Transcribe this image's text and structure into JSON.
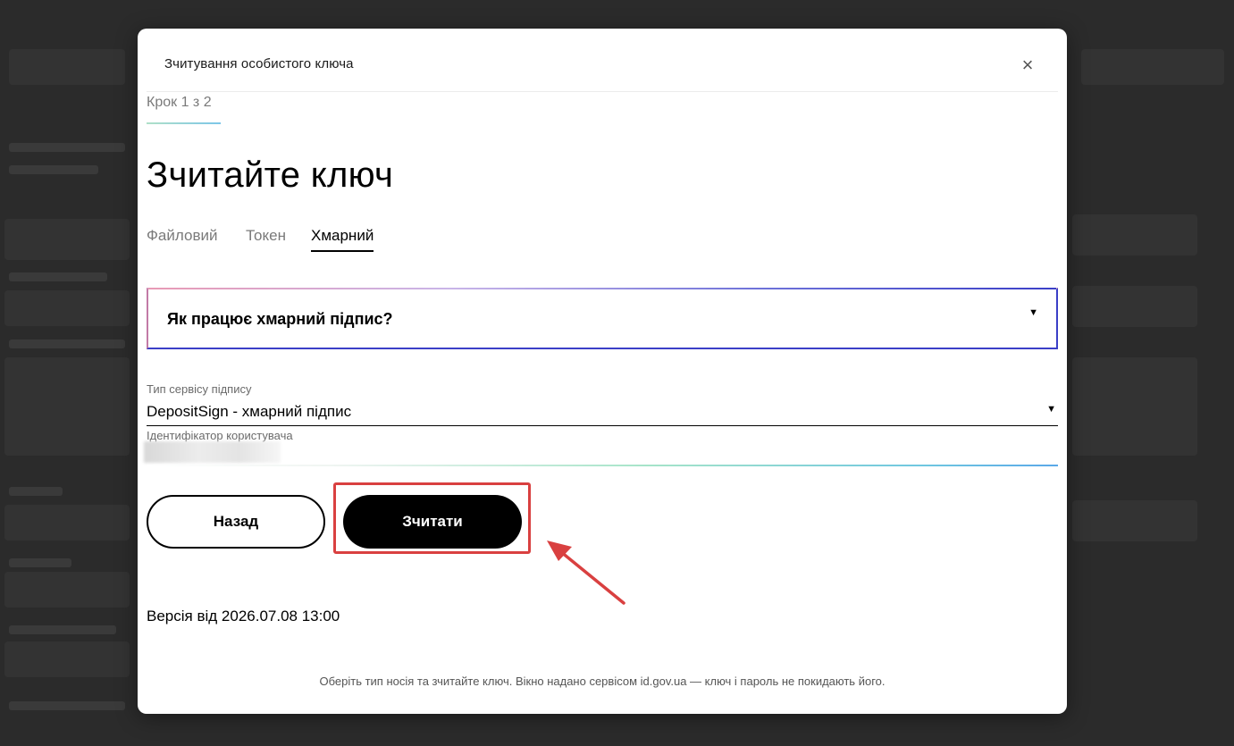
{
  "modal": {
    "title": "Зчитування особистого ключа",
    "close_label": "×",
    "step_label": "Крок 1 з 2",
    "heading": "Зчитайте ключ",
    "tabs": [
      {
        "label": "Файловий",
        "active": false
      },
      {
        "label": "Токен",
        "active": false
      },
      {
        "label": "Хмарний",
        "active": true
      }
    ],
    "accordion": {
      "title": "Як працює хмарний підпис?",
      "icon": "triangle-down-icon"
    },
    "service_type": {
      "label": "Тип сервісу підпису",
      "value": "DepositSign - хмарний підпис",
      "icon": "triangle-down-icon"
    },
    "user_id": {
      "label": "Ідентифікатор користувача",
      "value": ""
    },
    "buttons": {
      "back": "Назад",
      "read": "Зчитати"
    },
    "version": "Версія від 2026.07.08 13:00",
    "footer": "Оберіть тип носія та зчитайте ключ. Вікно надано сервісом id.gov.ua — ключ і пароль не покидають його."
  },
  "colors": {
    "overlay": "#2b2b2b",
    "accent_border": "#3b3fc7",
    "highlight": "#d94040",
    "primary_button": "#000000"
  }
}
